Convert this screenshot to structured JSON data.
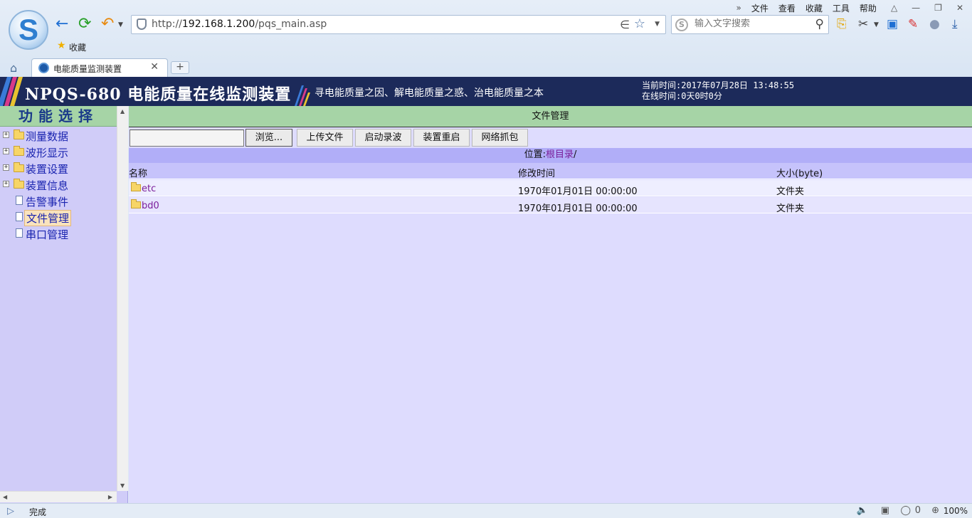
{
  "browser": {
    "menu": [
      "文件",
      "查看",
      "收藏",
      "工具",
      "帮助"
    ],
    "url_prefix": "http://",
    "url_host": "192.168.1.200",
    "url_path": "/pqs_main.asp",
    "search_placeholder": "输入文字搜索",
    "favorites_label": "收藏",
    "tab_title": "电能质量监测装置",
    "new_tab_symbol": "+",
    "status_text": "完成",
    "shield_count": "0",
    "zoom": "100%"
  },
  "header": {
    "device_title": "NPQS-680 电能质量在线监测装置",
    "slogan": "寻电能质量之因、解电能质量之惑、治电能质量之本",
    "current_time_label": "当前时间:",
    "current_time": "2017年07月28日 13:48:55",
    "online_time_label": "在线时间:",
    "online_time": "0天0时0分"
  },
  "sidebar": {
    "title": "功能选择",
    "items": [
      {
        "label": "测量数据",
        "type": "folder"
      },
      {
        "label": "波形显示",
        "type": "folder"
      },
      {
        "label": "装置设置",
        "type": "folder"
      },
      {
        "label": "装置信息",
        "type": "folder"
      },
      {
        "label": "告警事件",
        "type": "page"
      },
      {
        "label": "文件管理",
        "type": "page",
        "selected": true
      },
      {
        "label": "串口管理",
        "type": "page"
      }
    ]
  },
  "main": {
    "title": "文件管理",
    "toolbar": {
      "browse": "浏览...",
      "upload": "上传文件",
      "start_record": "启动录波",
      "restart": "装置重启",
      "capture": "网络抓包"
    },
    "location_label": "位置:",
    "location_path": "根目录",
    "location_sep": "/",
    "columns": [
      "名称",
      "修改时间",
      "大小(byte)"
    ],
    "rows": [
      {
        "name": "etc",
        "mtime": "1970年01月01日 00:00:00",
        "size": "文件夹"
      },
      {
        "name": "bd0",
        "mtime": "1970年01月01日 00:00:00",
        "size": "文件夹"
      }
    ]
  },
  "colors": {
    "header_bg": "#1c2a5a",
    "title_green": "#a6d4a6",
    "sidebar_bg": "#d0ccf8",
    "content_bg": "#dedcfe",
    "link_purple": "#7a1e9a",
    "nav_blue": "#1a24b0"
  }
}
